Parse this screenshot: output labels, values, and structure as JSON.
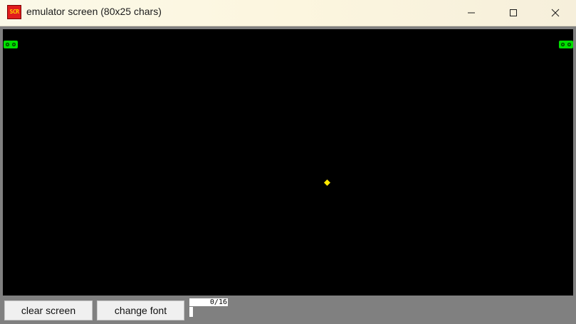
{
  "window": {
    "title": "emulator screen (80x25 chars)",
    "icon": "emulator-app-icon",
    "icon_text": "SCR",
    "controls": [
      "minimize-icon",
      "maximize-icon",
      "close-icon"
    ]
  },
  "screen": {
    "background": "#000000",
    "glyphs": [
      {
        "name": "green-face-glyph",
        "color": "#00e000"
      },
      {
        "name": "green-face-glyph",
        "color": "#00e000"
      },
      {
        "name": "yellow-diamond-glyph",
        "color": "#ffe800"
      }
    ]
  },
  "toolbar": {
    "clear_label": "clear screen",
    "font_label": "change font",
    "counter": "0/16"
  }
}
